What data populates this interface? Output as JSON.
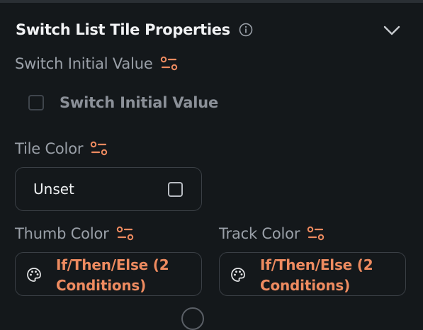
{
  "panel": {
    "title": "Switch List Tile Properties"
  },
  "switch_initial_value": {
    "label": "Switch Initial Value",
    "checkbox_label": "Switch Initial Value",
    "checked": false
  },
  "tile_color": {
    "label": "Tile Color",
    "value": "Unset"
  },
  "thumb_color": {
    "label": "Thumb Color",
    "value": "If/Then/Else (2 Conditions)"
  },
  "track_color": {
    "label": "Track Color",
    "value": "If/Then/Else (2 Conditions)"
  },
  "colors": {
    "background": "#14181b",
    "accent": "#ee8b60",
    "label": "#9aa0a8",
    "border": "#3a3f45"
  },
  "icons": {
    "info": "info-icon",
    "collapse": "chevron-down-icon",
    "variable": "variable-settings-icon",
    "palette": "palette-icon"
  }
}
